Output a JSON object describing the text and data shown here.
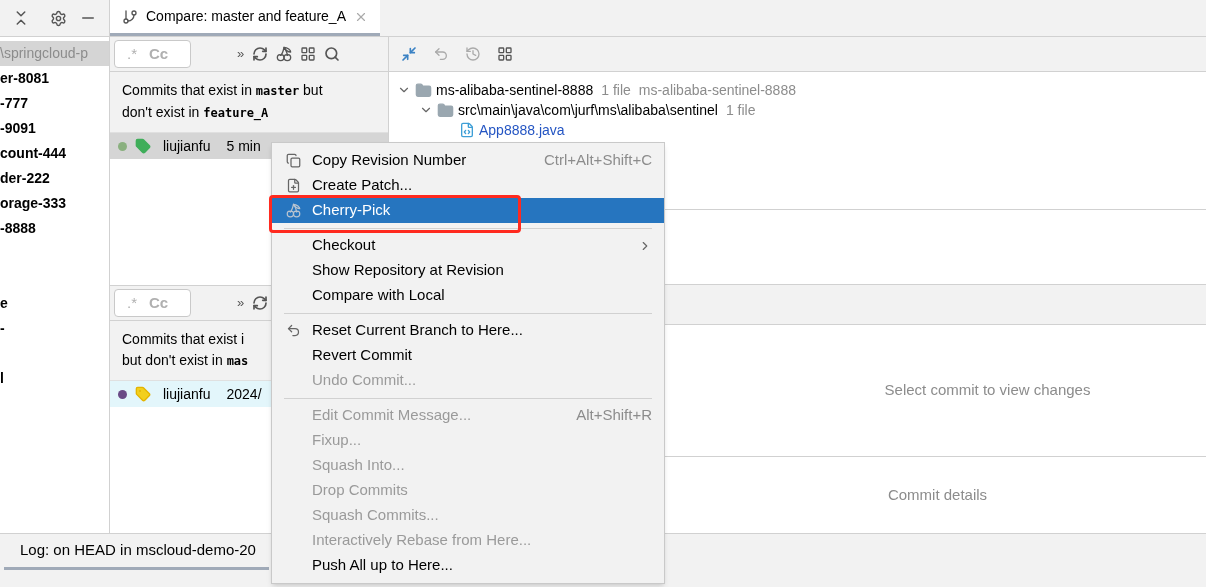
{
  "tab": {
    "title": "Compare: master and feature_A",
    "selected": true
  },
  "sidebar": {
    "items": [
      {
        "label": "\\springcloud-p",
        "selected": true
      },
      {
        "label": "er-8081",
        "selected": false
      },
      {
        "label": "-777",
        "selected": false
      },
      {
        "label": "-9091",
        "selected": false
      },
      {
        "label": "count-444",
        "selected": false
      },
      {
        "label": "der-222",
        "selected": false
      },
      {
        "label": "orage-333",
        "selected": false
      },
      {
        "label": "-8888",
        "selected": false
      },
      {
        "selected": false
      },
      {
        "selected": false
      },
      {
        "label": "e",
        "selected": false
      },
      {
        "label": "-",
        "selected": false
      },
      {
        "selected": false
      },
      {
        "label": "l",
        "selected": false
      }
    ]
  },
  "commit_panes": [
    {
      "regex_toggle": ".*",
      "case_toggle": "Cc",
      "overflow": "»",
      "description": [
        "Commits that exist in **master** but",
        "don't exist in **feature_A**"
      ],
      "commits": [
        {
          "author": "liujianfu",
          "time": "5 min",
          "color": "#8ab07f",
          "selected": true
        }
      ]
    },
    {
      "regex_toggle": ".*",
      "case_toggle": "Cc",
      "overflow": "»",
      "description": [
        "Commits that exist i",
        "but don't exist in **mas**"
      ],
      "commits": [
        {
          "author": "liujianfu",
          "time": "2024/",
          "color": "#6a4a86",
          "selected": false,
          "highlighted": true
        }
      ]
    }
  ],
  "changes": {
    "tree": [
      {
        "label": "ms-alibaba-sentinel-8888",
        "count": "1 file",
        "path": "ms-alibaba-sentinel-8888",
        "kind": "module",
        "expanded": true,
        "children": [
          {
            "label": "src\\main\\java\\com\\jurf\\ms\\alibaba\\sentinel",
            "count": "1 file",
            "kind": "folder",
            "expanded": true,
            "children": [
              {
                "label": "App8888.java",
                "kind": "file"
              }
            ]
          }
        ]
      }
    ],
    "empty_text": "Select commit to view changes",
    "details_text": "Commit details"
  },
  "status_bar": {
    "title": "Log: on HEAD in mscloud-demo-20"
  },
  "context_menu": {
    "items": [
      {
        "kind": "item",
        "label": "Copy Revision Number",
        "shortcut": "Ctrl+Alt+Shift+C",
        "disabled": false,
        "selected": false,
        "submenu": false
      },
      {
        "kind": "item",
        "label": "Create Patch...",
        "disabled": false,
        "selected": false,
        "submenu": false
      },
      {
        "kind": "item",
        "label": "Cherry-Pick",
        "disabled": false,
        "selected": true,
        "submenu": false,
        "annotated": true
      },
      {
        "kind": "separator"
      },
      {
        "kind": "item",
        "label": "Checkout",
        "disabled": false,
        "selected": false,
        "submenu": true
      },
      {
        "kind": "item",
        "label": "Show Repository at Revision",
        "disabled": false,
        "selected": false,
        "submenu": false
      },
      {
        "kind": "item",
        "label": "Compare with Local",
        "disabled": false,
        "selected": false,
        "submenu": false
      },
      {
        "kind": "separator"
      },
      {
        "kind": "item",
        "label": "Reset Current Branch to Here...",
        "disabled": false,
        "selected": false,
        "submenu": false
      },
      {
        "kind": "item",
        "label": "Revert Commit",
        "disabled": false,
        "selected": false,
        "submenu": false
      },
      {
        "kind": "item",
        "label": "Undo Commit...",
        "disabled": true,
        "selected": false,
        "submenu": false
      },
      {
        "kind": "separator"
      },
      {
        "kind": "item",
        "label": "Edit Commit Message...",
        "shortcut": "Alt+Shift+R",
        "disabled": true,
        "selected": false,
        "submenu": false
      },
      {
        "kind": "item",
        "label": "Fixup...",
        "disabled": true,
        "selected": false,
        "submenu": false
      },
      {
        "kind": "item",
        "label": "Squash Into...",
        "disabled": true,
        "selected": false,
        "submenu": false
      },
      {
        "kind": "item",
        "label": "Drop Commits",
        "disabled": true,
        "selected": false,
        "submenu": false
      },
      {
        "kind": "item",
        "label": "Squash Commits...",
        "disabled": true,
        "selected": false,
        "submenu": false
      },
      {
        "kind": "item",
        "label": "Interactively Rebase from Here...",
        "disabled": true,
        "selected": false,
        "submenu": false
      },
      {
        "kind": "item",
        "label": "Push All up to Here...",
        "disabled": false,
        "selected": false,
        "submenu": false
      }
    ]
  }
}
